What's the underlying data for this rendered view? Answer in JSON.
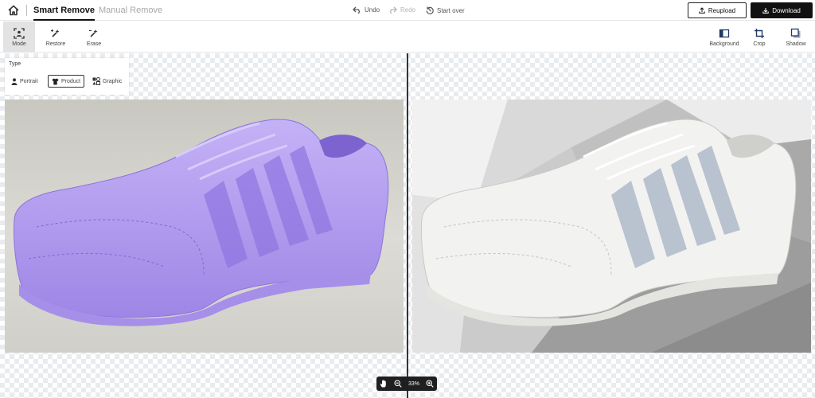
{
  "header": {
    "tabs": [
      {
        "label": "Smart Remove",
        "active": true
      },
      {
        "label": "Manual Remove",
        "active": false
      }
    ],
    "history": {
      "undo": "Undo",
      "redo": "Redo",
      "start_over": "Start over"
    },
    "reupload_label": "Reupload",
    "download_label": "Download"
  },
  "toolbar": {
    "left_tools": [
      {
        "label": "Mode",
        "icon": "mode-icon",
        "active": true
      },
      {
        "label": "Restore",
        "icon": "restore-wand-icon"
      },
      {
        "label": "Erase",
        "icon": "erase-wand-icon"
      }
    ],
    "right_tools": [
      {
        "label": "Background",
        "icon": "background-icon"
      },
      {
        "label": "Crop",
        "icon": "crop-icon"
      },
      {
        "label": "Shadow",
        "icon": "shadow-icon"
      }
    ]
  },
  "type_panel": {
    "title": "Type",
    "options": [
      {
        "label": "Portrait",
        "icon": "person-icon"
      },
      {
        "label": "Product",
        "icon": "shirt-icon",
        "selected": true
      },
      {
        "label": "Graphic",
        "icon": "shapes-icon"
      }
    ]
  },
  "zoom": {
    "level": "33%"
  },
  "colors": {
    "accent": "#111111",
    "mask_overlay": "#b49cf0",
    "checker": "#e9ecef"
  }
}
